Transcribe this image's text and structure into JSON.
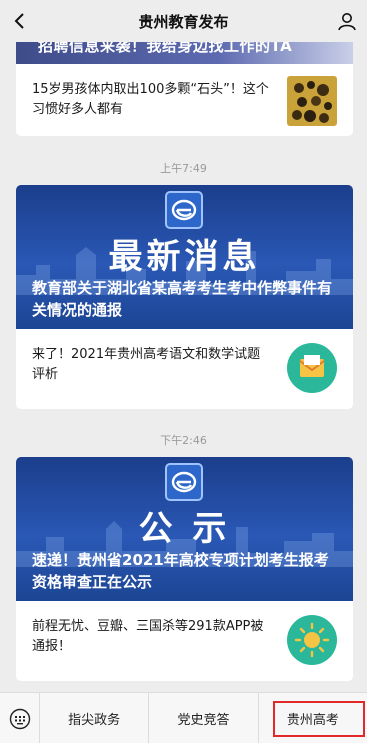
{
  "header": {
    "title": "贵州教育发布"
  },
  "cards": [
    {
      "cut_banner_text": "招聘信息来袭！我给身边找工作的TA",
      "row": {
        "text": "15岁男孩体内取出100多颗“石头”！这个习惯好多人都有",
        "icon": "stones-photo"
      }
    },
    {
      "banner_big": "最新消息",
      "banner_headline": "教育部关于湖北省某高考考生考中作弊事件有关情况的通报",
      "row": {
        "text": "来了！2021年贵州高考语文和数学试题评析",
        "icon": "envelope-icon"
      }
    },
    {
      "banner_big": "公  示",
      "banner_headline": "速递！贵州省2021年高校专项计划考生报考资格审查正在公示",
      "row": {
        "text": "前程无忧、豆瓣、三国杀等291款APP被通报！",
        "icon": "sun-icon"
      }
    }
  ],
  "timestamps": [
    "上午7:49",
    "下午2:46"
  ],
  "bottom_menu": [
    "指尖政务",
    "党史竞答",
    "贵州高考"
  ],
  "colors": {
    "highlight_box": "#e12929",
    "banner_blue": "#1b3e8c"
  }
}
